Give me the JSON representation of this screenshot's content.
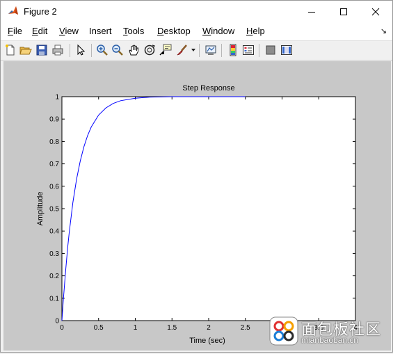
{
  "window": {
    "title": "Figure 2",
    "buttons": [
      "minimize",
      "maximize",
      "close"
    ]
  },
  "menubar": {
    "items": [
      {
        "acc": "F",
        "rest": "ile"
      },
      {
        "acc": "E",
        "rest": "dit"
      },
      {
        "acc": "V",
        "rest": "iew"
      },
      {
        "acc": "",
        "pre": "Insert",
        "rest": ""
      },
      {
        "acc": "T",
        "rest": "ools"
      },
      {
        "acc": "D",
        "rest": "esktop"
      },
      {
        "acc": "W",
        "rest": "indow"
      },
      {
        "acc": "H",
        "rest": "elp"
      }
    ],
    "overflow_arrow": "↘"
  },
  "toolbar": {
    "icons": [
      "new-figure-icon",
      "open-file-icon",
      "save-icon",
      "print-icon",
      "edit-plot-icon",
      "zoom-in-icon",
      "zoom-out-icon",
      "pan-icon",
      "rotate-3d-icon",
      "data-cursor-icon",
      "brush-icon",
      "link-plot-icon",
      "colorbar-icon",
      "legend-icon",
      "hide-plot-tools-icon",
      "show-plot-tools-icon"
    ]
  },
  "chart_data": {
    "type": "line",
    "title": "Step Response",
    "xlabel": "Time (sec)",
    "ylabel": "Amplitude",
    "xlim": [
      0,
      4
    ],
    "ylim": [
      0,
      1
    ],
    "x_ticks": [
      "0",
      "0.5",
      "1",
      "1.5",
      "2",
      "2.5",
      "3",
      "3.5",
      "4"
    ],
    "y_ticks": [
      "0",
      "0.1",
      "0.2",
      "0.3",
      "0.4",
      "0.5",
      "0.6",
      "0.7",
      "0.8",
      "0.9",
      "1"
    ],
    "series": [
      {
        "color": "#0000ff",
        "x": [
          0,
          0.02,
          0.05,
          0.08,
          0.1,
          0.15,
          0.2,
          0.25,
          0.3,
          0.35,
          0.4,
          0.5,
          0.6,
          0.7,
          0.8,
          1.0,
          1.2,
          1.5,
          2.0,
          2.5
        ],
        "y": [
          0,
          0.095,
          0.221,
          0.33,
          0.393,
          0.528,
          0.632,
          0.713,
          0.777,
          0.826,
          0.865,
          0.918,
          0.95,
          0.97,
          0.982,
          0.993,
          0.998,
          1.0,
          1.0,
          1.0
        ]
      }
    ],
    "steady_state": 1.0,
    "steady_state_line_end": 2.5,
    "colors": {
      "axes_bg": "#ffffff",
      "figure_bg": "#c8c8c8",
      "line": "#0000ff"
    }
  },
  "watermark": {
    "main": "面包板社区",
    "sub": "mianbaoban.cn"
  }
}
